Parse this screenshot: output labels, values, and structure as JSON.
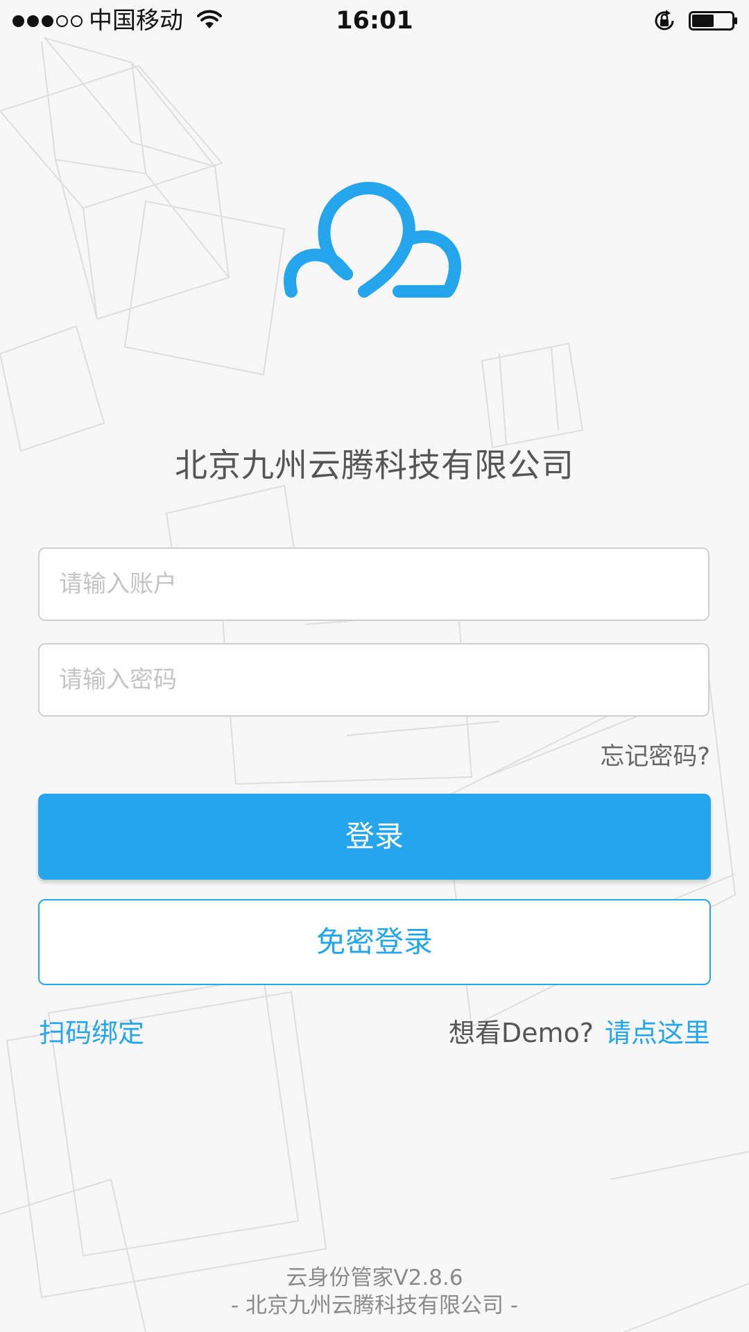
{
  "status_bar": {
    "carrier": "中国移动",
    "time": "16:01",
    "signal_bars_filled": 3,
    "signal_bars_total": 5,
    "battery_level": 0.55,
    "icons": [
      "wifi-icon",
      "rotation-lock-icon",
      "battery-icon"
    ]
  },
  "brand": {
    "logo_icon": "cloud-logo-icon",
    "accent_color": "#25a6ec",
    "company_name": "北京九州云腾科技有限公司"
  },
  "form": {
    "account_placeholder": "请输入账户",
    "account_value": "",
    "password_placeholder": "请输入密码",
    "password_value": "",
    "forgot_password": "忘记密码?"
  },
  "actions": {
    "login": "登录",
    "passwordless_login": "免密登录",
    "scan_bind": "扫码绑定",
    "demo_prompt": "想看Demo?",
    "demo_link": "请点这里"
  },
  "footer": {
    "version": "云身份管家V2.8.6",
    "company": "- 北京九州云腾科技有限公司 -"
  }
}
